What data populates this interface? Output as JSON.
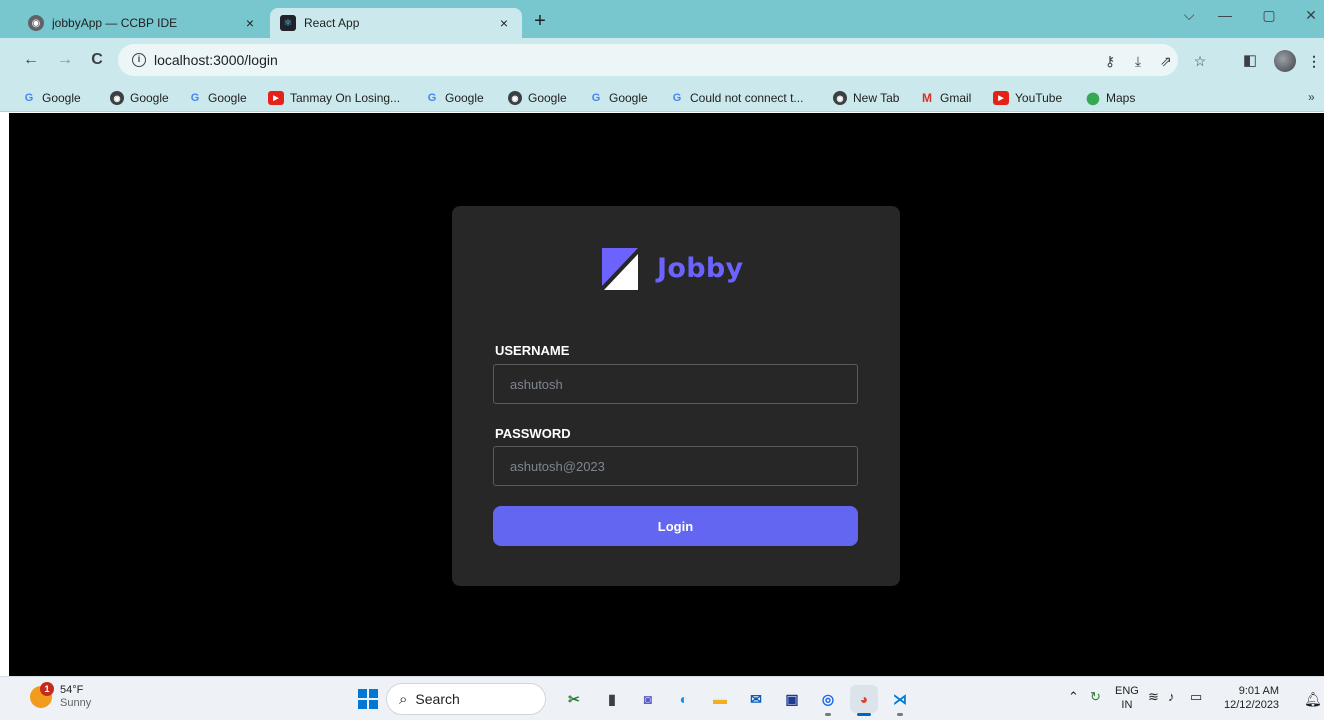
{
  "browser": {
    "tabs": [
      {
        "title": "jobbyApp — CCBP IDE",
        "close": "×",
        "favicon": "globe-icon"
      },
      {
        "title": "React App",
        "close": "×",
        "favicon": "react-icon"
      }
    ],
    "new_tab": "+",
    "window_controls": {
      "minimize": "—",
      "restore": "▢",
      "close": "✕",
      "tab_search": "⌵"
    },
    "url": "localhost:3000/login",
    "bookmarks": [
      {
        "label": "Google",
        "icon": "google-icon"
      },
      {
        "label": "Google",
        "icon": "globe-icon"
      },
      {
        "label": "Google",
        "icon": "google-icon"
      },
      {
        "label": "Tanmay On Losing...",
        "icon": "youtube-icon"
      },
      {
        "label": "Google",
        "icon": "google-icon"
      },
      {
        "label": "Google",
        "icon": "globe-icon"
      },
      {
        "label": "Google",
        "icon": "google-icon"
      },
      {
        "label": "Could not connect t...",
        "icon": "google-icon"
      },
      {
        "label": "New Tab",
        "icon": "globe-icon"
      },
      {
        "label": "Gmail",
        "icon": "gmail-icon"
      },
      {
        "label": "YouTube",
        "icon": "youtube-icon"
      },
      {
        "label": "Maps",
        "icon": "maps-icon"
      }
    ],
    "bookmarks_more": "»"
  },
  "page": {
    "brand": "Jobby",
    "username": {
      "label": "USERNAME",
      "placeholder": "ashutosh"
    },
    "password": {
      "label": "PASSWORD",
      "placeholder": "ashutosh@2023"
    },
    "login_button": "Login",
    "colors": {
      "background": "#000000",
      "card": "#272727",
      "accent": "#6366f1",
      "brand": "#6c63ff"
    }
  },
  "taskbar": {
    "weather": {
      "temp": "54°F",
      "condition": "Sunny",
      "badge": "1"
    },
    "search_label": "Search",
    "language": {
      "line1": "ENG",
      "line2": "IN"
    },
    "time": "9:01 AM",
    "date": "12/12/2023"
  }
}
